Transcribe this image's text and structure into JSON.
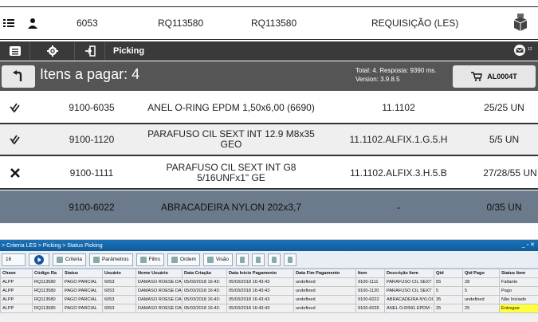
{
  "header": {
    "left_icon": "menu-list-icon",
    "user_icon": "user-icon",
    "code": "6053",
    "rq1": "RQ113580",
    "rq2": "RQ113580",
    "status": "REQUISIÇÃO (LES)",
    "box_icon": "package-icon"
  },
  "toolbar": {
    "menu_icon": "list-icon",
    "gear_icon": "gear-icon",
    "login_icon": "login-icon",
    "title": "Picking",
    "mail_icon": "mail-icon",
    "mail_count": "12"
  },
  "summary": {
    "back_icon": "back-arrow-icon",
    "label": "Itens a pagar: 4",
    "total": "Total: 4. Resposta: 9390 ms.",
    "version": "Version: 3.9.8.5",
    "action_label": "AL0004T",
    "action_icon": "cart-icon"
  },
  "items": [
    {
      "status_icon": "double-check-icon",
      "code": "9100-6035",
      "desc": "ANEL O-RING EPDM 1,50x6,00 (6690)",
      "loc": "11.1102",
      "qty": "25/25 UN"
    },
    {
      "status_icon": "double-check-icon",
      "code": "9100-1120",
      "desc": "PARAFUSO CIL SEXT INT 12.9  M8x35 GEO",
      "loc": "11.1102.ALFIX.1.G.5.H",
      "qty": "5/5 UN"
    },
    {
      "status_icon": "close-icon",
      "code": "9100-1111",
      "desc": "PARAFUSO CIL SEXT INT G8 5/16UNFx1\" GE",
      "loc": "11.1102.ALFIX.3.H.5.B",
      "qty": "27/28/55 UN"
    },
    {
      "status_icon": "",
      "code": "9100-6022",
      "desc": "ABRACADEIRA NYLON 202x3,7",
      "loc": "-",
      "qty": "0/35 UN"
    }
  ],
  "pane": {
    "breadcrumb": "> Criteria LES > Picking > Status Picking",
    "window_controls": "_ ▫ ✕",
    "page_size": "16",
    "buttons": [
      "Criteria",
      "Parâmetros",
      "Filtro",
      "Ordem",
      "Visão"
    ],
    "columns": [
      "Chave",
      "Código Ra",
      "Status",
      "Usuário",
      "Nome Usuário",
      "Data Criação",
      "Data Início Pagamento",
      "Data Fim Pagamento",
      "Item",
      "Descrição Item",
      "Qtd",
      "Qtd Pago",
      "Status Item"
    ],
    "rows": [
      [
        "ALPP",
        "RQ113580",
        "PAGO PARCIAL",
        "6053",
        "DAMASO ROESE DA",
        "05/03/2018 16:43:",
        "05/03/2018 16:43:43",
        "undefined",
        "9100-1111",
        "PARAFUSO CIL SEXT",
        "55",
        "28",
        "Faltante"
      ],
      [
        "ALPP",
        "RQ113580",
        "PAGO PARCIAL",
        "6053",
        "DAMASO ROESE DA",
        "05/03/2018 16:43:",
        "05/03/2018 16:43:43",
        "undefined",
        "9100-1120",
        "PARAFUSO CIL SEXT",
        "5",
        "5",
        "Pago"
      ],
      [
        "ALPP",
        "RQ113580",
        "PAGO PARCIAL",
        "6053",
        "DAMASO ROESE DA",
        "05/03/2018 16:43:",
        "05/03/2018 16:43:43",
        "undefined",
        "9100-6022",
        "ABRACADEIRA NYLOI",
        "35",
        "undefined",
        "Não Iniciado"
      ],
      [
        "ALPP",
        "RQ113580",
        "PAGO PARCIAL",
        "6053",
        "DAMASO ROESE DA",
        "05/03/2018 16:43:",
        "05/03/2018 16:43:43",
        "undefined",
        "9100-6035",
        "ANEL O-RING EPDM :",
        "25",
        "25",
        "Entregue"
      ]
    ]
  }
}
